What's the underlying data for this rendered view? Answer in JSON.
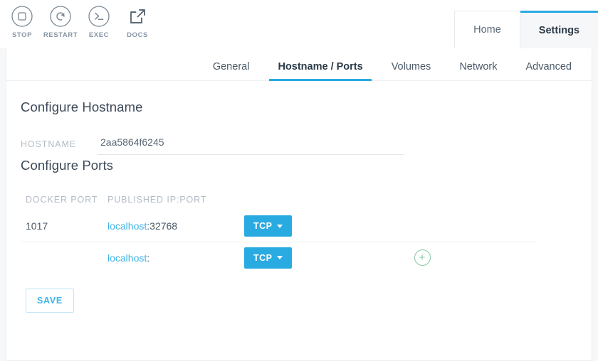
{
  "toolbar": {
    "actions": [
      {
        "label": "STOP",
        "icon": "stop-icon"
      },
      {
        "label": "RESTART",
        "icon": "restart-icon"
      },
      {
        "label": "EXEC",
        "icon": "terminal-icon"
      },
      {
        "label": "DOCS",
        "icon": "external-link-icon"
      }
    ]
  },
  "top_nav": {
    "tabs": [
      {
        "label": "Home",
        "active": false
      },
      {
        "label": "Settings",
        "active": true
      }
    ]
  },
  "section_tabs": [
    {
      "label": "General",
      "active": false
    },
    {
      "label": "Hostname / Ports",
      "active": true
    },
    {
      "label": "Volumes",
      "active": false
    },
    {
      "label": "Network",
      "active": false
    },
    {
      "label": "Advanced",
      "active": false
    }
  ],
  "hostname_section": {
    "title": "Configure Hostname",
    "label": "HOSTNAME",
    "value": "2aa5864f6245",
    "placeholder": ""
  },
  "ports_section": {
    "title": "Configure Ports",
    "columns": {
      "docker_port": "DOCKER PORT",
      "published": "PUBLISHED IP:PORT"
    },
    "rows": [
      {
        "docker_port": "1017",
        "host": "localhost",
        "separator": ":",
        "port": "32768",
        "protocol": "TCP",
        "has_add": false
      },
      {
        "docker_port": "",
        "host": "localhost",
        "separator": ":",
        "port": "",
        "protocol": "TCP",
        "has_add": true
      }
    ],
    "add_label": "+"
  },
  "save_button": {
    "label": "SAVE"
  },
  "colors": {
    "accent_blue": "#29abe2",
    "link_blue": "#3fb4e8",
    "add_green": "#84c9a0",
    "muted": "#b3bcc6"
  }
}
